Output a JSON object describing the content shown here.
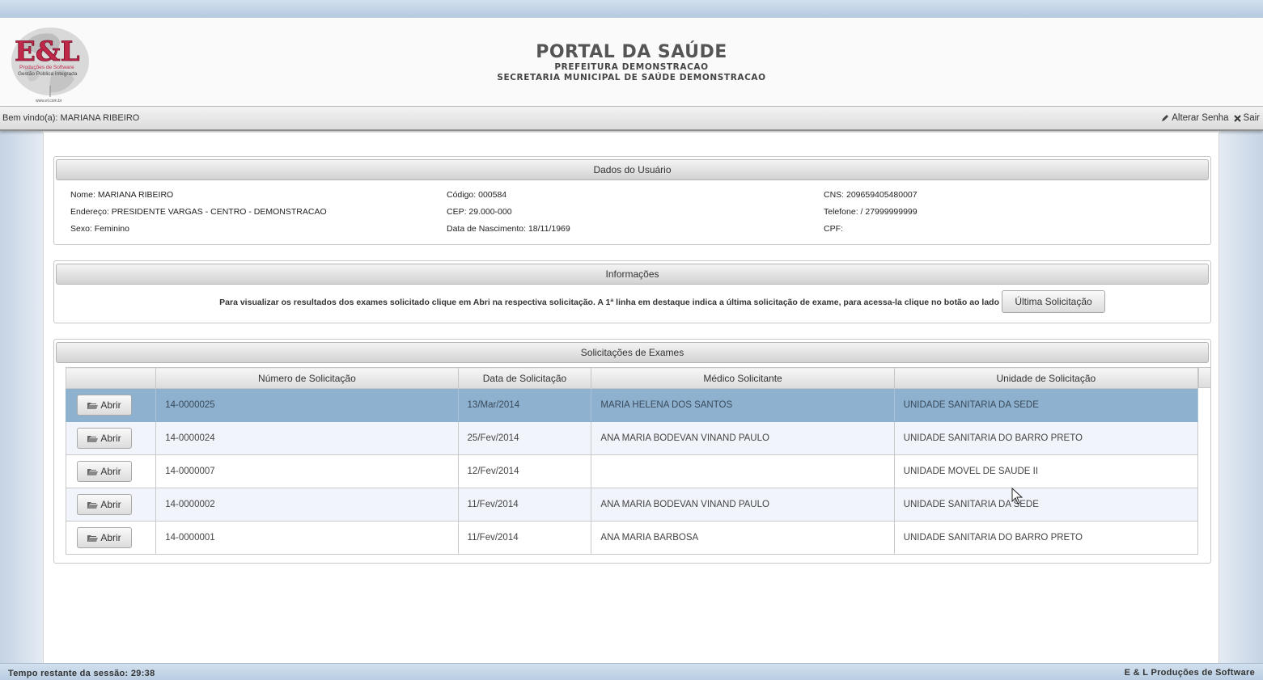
{
  "header": {
    "logo_text": "E&L",
    "logo_tagline": "Produções de Software",
    "logo_sub": "Gestão Pública Integrada",
    "logo_url": "www.el.com.br",
    "title": "PORTAL DA SAÚDE",
    "subtitle1": "PREFEITURA DEMONSTRACAO",
    "subtitle2": "SECRETARIA MUNICIPAL DE SAÚDE DEMONSTRACAO"
  },
  "userbar": {
    "welcome": "Bem vindo(a): MARIANA RIBEIRO",
    "change_password": "Alterar Senha",
    "logout": "Sair"
  },
  "user_data": {
    "title": "Dados do Usuário",
    "nome": "Nome: MARIANA RIBEIRO",
    "endereco": "Endereço: PRESIDENTE VARGAS - CENTRO - DEMONSTRACAO",
    "sexo": "Sexo: Feminino",
    "codigo": "Código: 000584",
    "cep": "CEP: 29.000-000",
    "nascimento": "Data de Nascimento: 18/11/1969",
    "cns": "CNS: 209659405480007",
    "telefone": "Telefone: / 27999999999",
    "cpf": "CPF:"
  },
  "info": {
    "title": "Informações",
    "text": "Para visualizar os resultados dos exames solicitado clique em Abri na respectiva solicitação. A 1ª linha em destaque indica a última solicitação de exame, para acessa-la clique no botão ao lado",
    "button_label": "Última Solicitação"
  },
  "requests": {
    "title": "Solicitações de Exames",
    "columns": [
      "",
      "Número de Solicitação",
      "Data de Solicitação",
      "Médico Solicitante",
      "Unidade de Solicitação"
    ],
    "open_label": "Abrir",
    "rows": [
      {
        "numero": "14-0000025",
        "data": "13/Mar/2014",
        "medico": "MARIA HELENA DOS SANTOS",
        "unidade": "UNIDADE SANITARIA DA SEDE"
      },
      {
        "numero": "14-0000024",
        "data": "25/Fev/2014",
        "medico": "ANA MARIA BODEVAN VINAND PAULO",
        "unidade": "UNIDADE SANITARIA DO BARRO PRETO"
      },
      {
        "numero": "14-0000007",
        "data": "12/Fev/2014",
        "medico": "",
        "unidade": "UNIDADE MOVEL DE SAUDE II"
      },
      {
        "numero": "14-0000002",
        "data": "11/Fev/2014",
        "medico": "ANA MARIA BODEVAN VINAND PAULO",
        "unidade": "UNIDADE SANITARIA DA SEDE"
      },
      {
        "numero": "14-0000001",
        "data": "11/Fev/2014",
        "medico": "ANA MARIA BARBOSA",
        "unidade": "UNIDADE SANITARIA DO BARRO PRETO"
      }
    ]
  },
  "footer": {
    "session": "Tempo restante da sessão:  29:38",
    "company": "E & L Produções de Software"
  },
  "colors": {
    "selected_row": "#8db1cf",
    "logo_red": "#c0284a",
    "bar_blue": "#c6d7e9"
  },
  "icons": [
    "pencil-icon",
    "close-icon",
    "folder-open-icon",
    "mouse-cursor-icon"
  ]
}
